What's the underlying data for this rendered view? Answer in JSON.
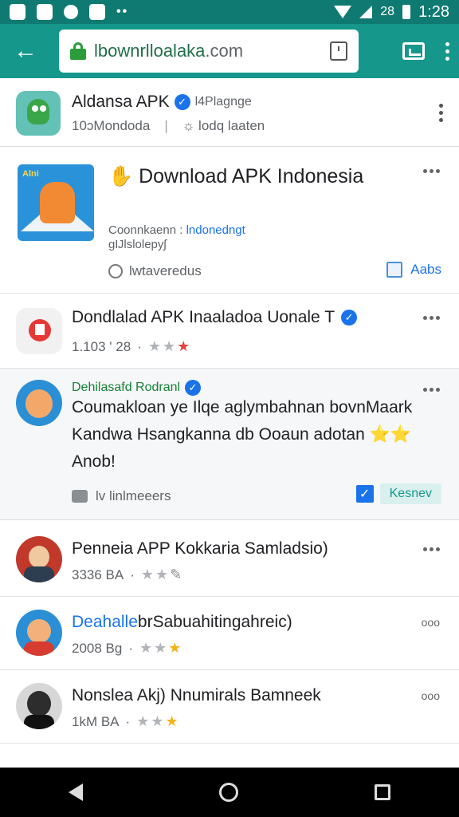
{
  "status_bar": {
    "time": "1:28",
    "battery_text": "28"
  },
  "toolbar": {
    "url_host": "lbownrlloalaka",
    "url_tld": ".com"
  },
  "header": {
    "title": "Aldansa APK",
    "tag": "l4Plagnge",
    "count": "10ɔMondoda",
    "sep": "|",
    "link": "lodq laaten"
  },
  "featured": {
    "thumb_text": "Alni",
    "title_prefix": "✋",
    "title": "Download APK Indonesia",
    "sub_label": "Coonnkaenn :",
    "sub_link": "lndonedngt",
    "sub_line2": "gĲlslolepyʃ",
    "meta": "lwtaveredus",
    "action": "Aabs"
  },
  "app1": {
    "name": "Dondlalad APK Inaaladoa Uonale T",
    "size": "1.103 ' 28",
    "dot": "·"
  },
  "post": {
    "author": "Dehilasafd Rodranl",
    "body": "Coumakloan ye Ilqe aglymbahnan bovnMaark Kandwa Hsangkanna db Ooaun adotan ⭐⭐ Anob!",
    "footer": "lv linlmeeers",
    "action": "Kesnev"
  },
  "list": [
    {
      "name": "Penneia APP Kokkaria Samladsio)",
      "meta": "3336  BA",
      "dot": "·",
      "name_color": "#202124"
    },
    {
      "name_blue": "Deahalle",
      "name": "brSabuahitingahreic)",
      "meta": "2008  Bg",
      "dot": "·"
    },
    {
      "name": "Nonslea Akj) Nnumirals Bamneek",
      "meta": "1kM  BA",
      "dot": "·"
    }
  ],
  "colors": {
    "accent": "#16978b",
    "status": "#0f7a72",
    "link": "#1a73e8",
    "star": "#f2b21b"
  },
  "icons": [
    "back-arrow-icon",
    "lock-icon",
    "tabs-icon",
    "cast-icon",
    "overflow-menu-icon",
    "verified-icon",
    "star-icon",
    "like-icon",
    "nav-back-icon",
    "nav-home-icon",
    "nav-recent-icon"
  ]
}
